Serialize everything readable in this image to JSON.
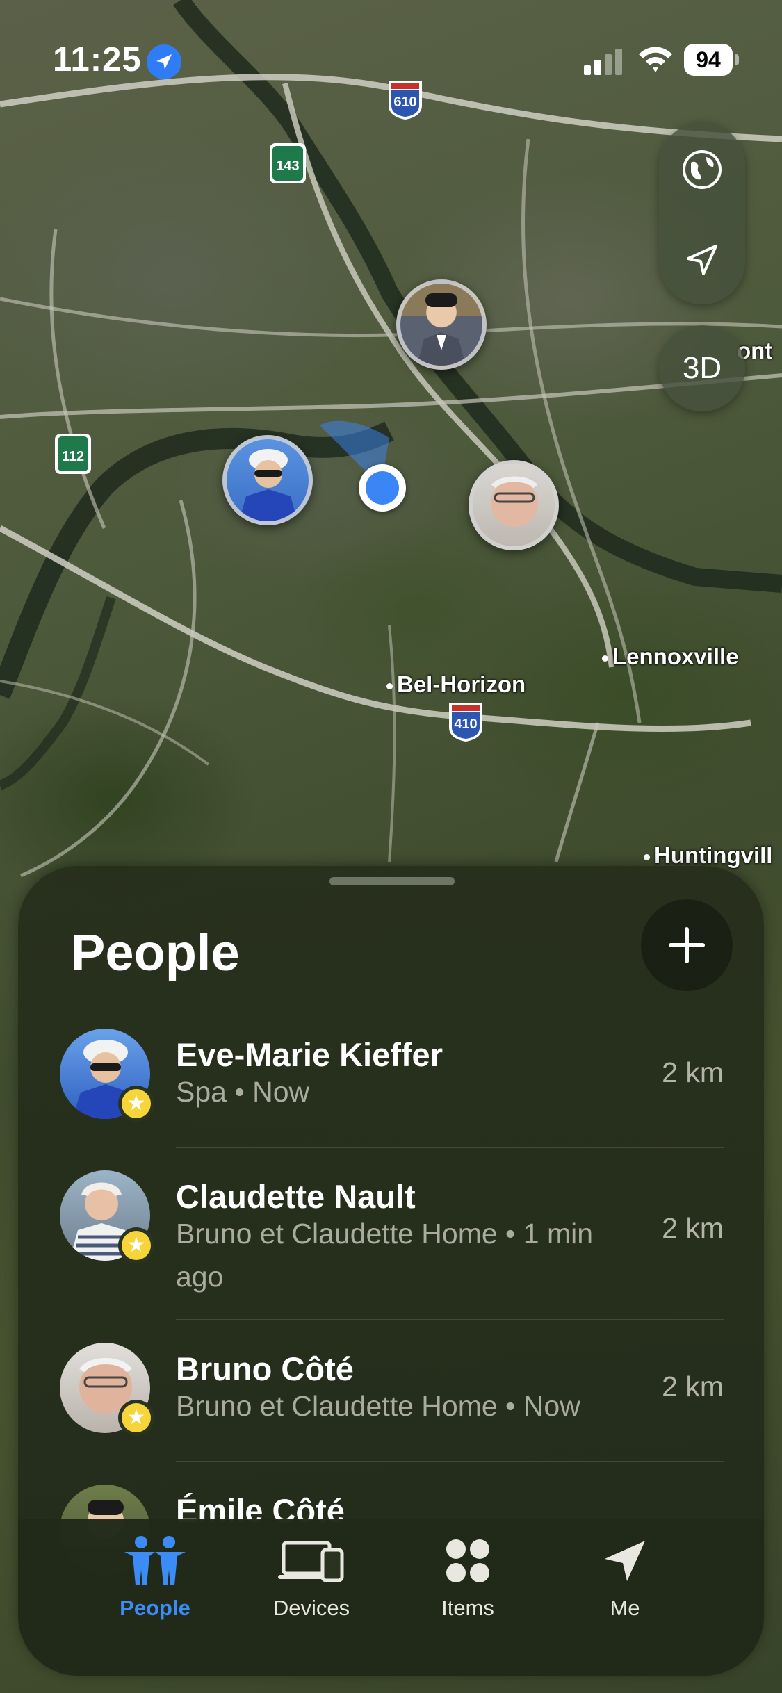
{
  "status_bar": {
    "time": "11:25",
    "battery": "94"
  },
  "map": {
    "shields": [
      "610",
      "143",
      "112",
      "410"
    ],
    "places": [
      "Bel-Horizon",
      "Lennoxville",
      "Huntingvill",
      "ont"
    ]
  },
  "map_controls": {
    "three_d_label": "3D"
  },
  "sheet": {
    "title": "People",
    "people": [
      {
        "name": "Eve-Marie Kieffer",
        "subtitle": "Spa • Now",
        "distance": "2 km"
      },
      {
        "name": "Claudette Nault",
        "subtitle": "Bruno et Claudette Home • 1 min ago",
        "distance": "2 km"
      },
      {
        "name": "Bruno Côté",
        "subtitle": "Bruno et Claudette Home • Now",
        "distance": "2 km"
      },
      {
        "name": "Émile Côté",
        "subtitle": "",
        "distance": ""
      }
    ]
  },
  "tabs": [
    {
      "label": "People",
      "icon": "people-icon",
      "active": true
    },
    {
      "label": "Devices",
      "icon": "devices-icon",
      "active": false
    },
    {
      "label": "Items",
      "icon": "items-icon",
      "active": false
    },
    {
      "label": "Me",
      "icon": "me-icon",
      "active": false
    }
  ],
  "colors": {
    "accent": "#3c8cf7",
    "favorite": "#f5d53a"
  }
}
